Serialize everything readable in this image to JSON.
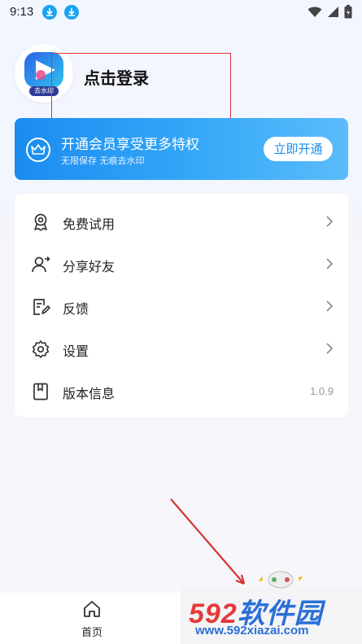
{
  "status_bar": {
    "time": "9:13",
    "icons": [
      "download-icon",
      "download-icon",
      "wifi-icon",
      "signal-icon",
      "battery-icon"
    ]
  },
  "profile": {
    "login_text": "点击登录",
    "logo_text": "去水印"
  },
  "vip": {
    "title": "开通会员享受更多特权",
    "subtitle": "无限保存 无痕去水印",
    "button": "立即开通",
    "icon": "crown-icon"
  },
  "menu": {
    "items": [
      {
        "label": "免费试用",
        "icon": "medal-icon"
      },
      {
        "label": "分享好友",
        "icon": "share-user-icon"
      },
      {
        "label": "反馈",
        "icon": "feedback-icon"
      },
      {
        "label": "设置",
        "icon": "gear-icon"
      },
      {
        "label": "版本信息",
        "icon": "book-icon",
        "value": "1.0.9"
      }
    ]
  },
  "tabbar": {
    "home": "首页"
  },
  "watermark": {
    "brand": "592软件园",
    "url": "www.592xiazai.com"
  },
  "colors": {
    "accent": "#1a8cf0",
    "annotation": "#d33333"
  }
}
